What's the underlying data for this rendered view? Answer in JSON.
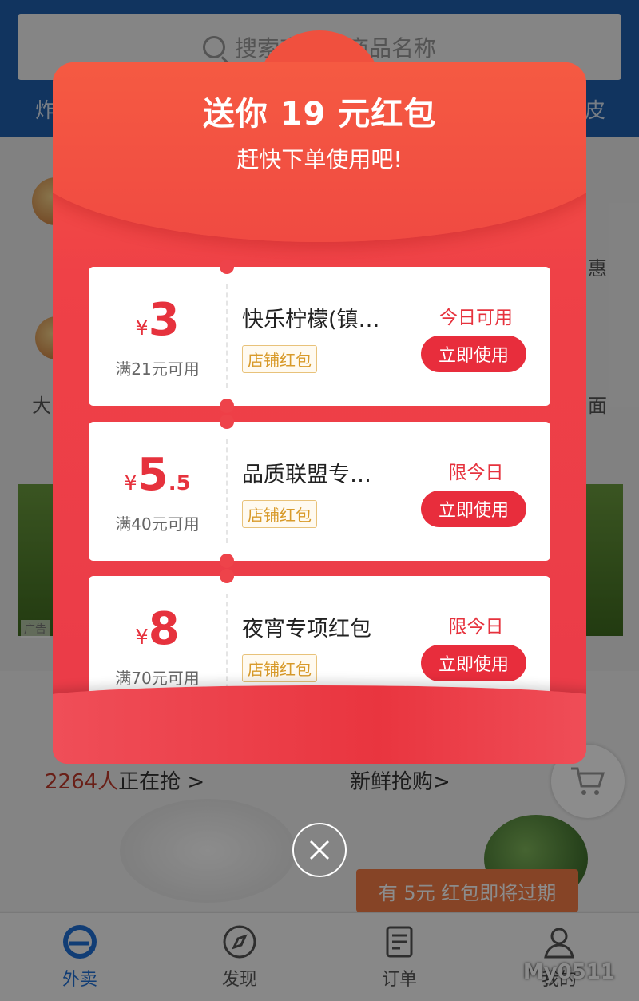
{
  "search": {
    "placeholder": "搜索商家、商品名称"
  },
  "hotwords": {
    "left": "炸",
    "right": "皮"
  },
  "background_categories": [
    {
      "label": "惠"
    },
    {
      "label": "大"
    },
    {
      "label": "面"
    }
  ],
  "ad_tag": "广告",
  "flash_sale": {
    "count": "2264人",
    "text": "正在抢 >",
    "fresh": "新鲜抢购>"
  },
  "expiry_notice": "有 5元 红包即将过期",
  "tabbar": {
    "tabs": [
      {
        "label": "外卖",
        "icon": "eleme-icon",
        "active": true
      },
      {
        "label": "发现",
        "icon": "compass-icon",
        "active": false
      },
      {
        "label": "订单",
        "icon": "order-icon",
        "active": false
      },
      {
        "label": "我的",
        "icon": "user-icon",
        "active": false
      }
    ]
  },
  "watermark": "My0511",
  "modal": {
    "title": "送你 19 元红包",
    "subtitle": "赶快下单使用吧!",
    "coupons": [
      {
        "currency": "¥",
        "amount": "3",
        "decimal": "",
        "condition": "满21元可用",
        "name": "快乐柠檬(镇…",
        "tag": "店铺红包",
        "availability": "今日可用",
        "action": "立即使用"
      },
      {
        "currency": "¥",
        "amount": "5",
        "decimal": ".5",
        "condition": "满40元可用",
        "name": "品质联盟专…",
        "tag": "店铺红包",
        "availability": "限今日",
        "action": "立即使用"
      },
      {
        "currency": "¥",
        "amount": "8",
        "decimal": "",
        "condition": "满70元可用",
        "name": "夜宵专项红包",
        "tag": "店铺红包",
        "availability": "限今日",
        "action": "立即使用"
      }
    ],
    "close_icon": "close-icon"
  },
  "colors": {
    "primary_red": "#e82d3c",
    "tab_active": "#1f6fd6",
    "topbar": "#1f5fae",
    "tag_gold": "#d89a2a"
  }
}
